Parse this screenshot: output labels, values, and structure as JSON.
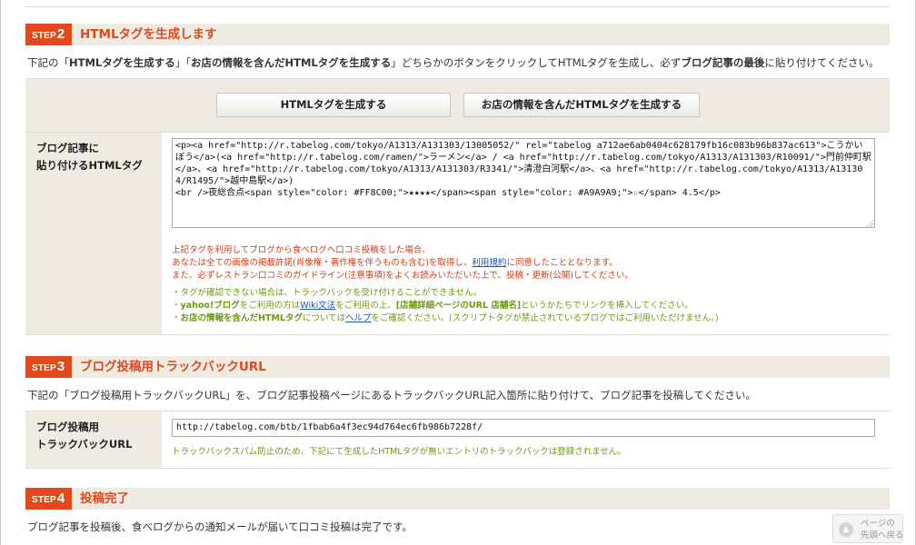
{
  "colors": {
    "accent": "#e04a1a",
    "section_bg": "#efebe3",
    "note_red": "#d63a10",
    "note_green": "#6a9a12",
    "link": "#1a56b0"
  },
  "step2": {
    "badge_prefix": "STEP",
    "badge_num": "2",
    "title": "HTMLタグを生成します",
    "desc_1": "下記の「",
    "desc_2": "HTMLタグを生成する",
    "desc_3": "」「",
    "desc_4": "お店の情報を含んだHTMLタグを生成する",
    "desc_5": "」どちらかのボタンをクリックしてHTMLタグを生成し、必ず",
    "desc_6": "ブログ記事の最後",
    "desc_7": "に貼り付けてください。",
    "button_generate": "HTMLタグを生成する",
    "button_generate_with_shop": "お店の情報を含んだHTMLタグを生成する",
    "label_line1": "ブログ記事に",
    "label_line2": "貼り付けるHTMLタグ",
    "textarea_value": "<p><a href=\"http://r.tabelog.com/tokyo/A1313/A131303/13005052/\" rel=\"tabelog a712ae6ab0404c628179fb16c083b96b837ac613\">こうかいぼう</a>(<a href=\"http://r.tabelog.com/ramen/\">ラーメン</a> / <a href=\"http://r.tabelog.com/tokyo/A1313/A131303/R10091/\">門前仲町駅</a>、<a href=\"http://r.tabelog.com/tokyo/A1313/A131303/R3341/\">清澄白河駅</a>、<a href=\"http://r.tabelog.com/tokyo/A1313/A131304/R1495/\">越中島駅</a>)\n<br />夜総合点<span style=\"color: #FF8C00;\">★★★★</span><span style=\"color: #A9A9A9;\">☆</span> 4.5</p>",
    "notice_red_1": "上記タグを利用してブログから食べログへ口コミ投稿をした場合、",
    "notice_red_2a": "あなたは全ての画像の掲載許諾(肖像権・著作権を伴うものも含む)を取得し、",
    "notice_red_2_link": "利用規約",
    "notice_red_2b": "に同意したこととなります。",
    "notice_red_3": "また、必ずレストラン口コミのガイドライン(注意事項)をよくお読みいただいた上で、投稿・更新(公開)してください。",
    "notice_green_1": "・タグが確認できない場合は、トラックバックを受け付けることができません。",
    "notice_green_2a": "・",
    "notice_green_2b": "yahoo!ブログ",
    "notice_green_2c": "をご利用の方は",
    "notice_green_2_link": "Wiki文法",
    "notice_green_2d": "をご利用の上、",
    "notice_green_2e": "[店舗詳細ページのURL 店舗名]",
    "notice_green_2f": "というかたちでリンクを挿入してください。",
    "notice_green_3a": "・",
    "notice_green_3b": "お店の情報を含んだHTMLタグ",
    "notice_green_3c": "については",
    "notice_green_3_link": "ヘルプ",
    "notice_green_3d": "をご確認ください。(スクリプトタグが禁止されているブログではご利用いただけません。)"
  },
  "step3": {
    "badge_prefix": "STEP",
    "badge_num": "3",
    "title": "ブログ投稿用トラックバックURL",
    "desc": "下記の「ブログ投稿用トラックバックURL」を、ブログ記事投稿ページにあるトラックバックURL記入箇所に貼り付けて、ブログ記事を投稿してください。",
    "label_line1": "ブログ投稿用",
    "label_line2": "トラックバックURL",
    "url_value": "http://tabelog.com/btb/1fbab6a4f3ec94d764ec6fb986b7228f/",
    "notice_green": "トラックバックスパム防止のため、下記にて生成したHTMLタグが無いエントリのトラックバックは登録されません。"
  },
  "step4": {
    "badge_prefix": "STEP",
    "badge_num": "4",
    "title": "投稿完了",
    "desc": "ブログ記事を投稿後、食べログからの通知メールが届いて口コミ投稿は完了です。"
  },
  "page_top": {
    "label": "ページの\n先頭へ戻る",
    "icon": "arrow-up-icon"
  }
}
